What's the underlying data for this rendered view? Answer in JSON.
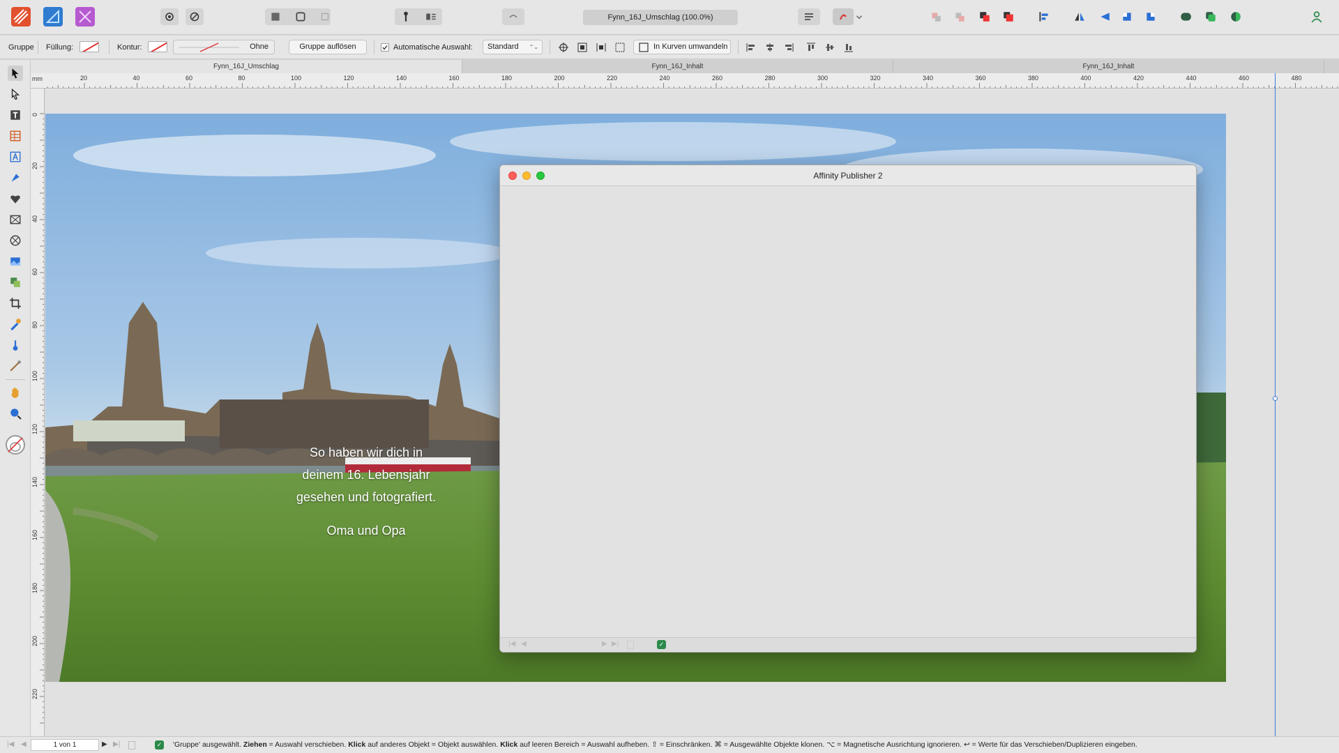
{
  "app": {
    "name": "Affinity Publisher 2"
  },
  "top_toolbar": {
    "document_title": "Fynn_16J_Umschlag (100.0%)",
    "persona_icons": [
      "publisher-persona-icon",
      "designer-persona-icon",
      "photo-persona-icon"
    ],
    "colors": {
      "publisher": "#e2502e",
      "designer": "#2f7bd0",
      "photo": "#b65ad0"
    }
  },
  "context_toolbar": {
    "selection_label": "Gruppe",
    "fill_label": "Füllung:",
    "stroke_label": "Kontur:",
    "stroke_style": "Ohne",
    "ungroup_button": "Gruppe auflösen",
    "auto_select_label": "Automatische Auswahl:",
    "auto_select_value": "Standard",
    "convert_curves_button": "In Kurven umwandeln"
  },
  "tabs": [
    {
      "label": "Fynn_16J_Umschlag",
      "active": true
    },
    {
      "label": "Fynn_16J_Inhalt",
      "active": false
    },
    {
      "label": "Fynn_16J_Inhalt",
      "active": false
    }
  ],
  "ruler": {
    "unit": "mm",
    "h_ticks": [
      "20",
      "40",
      "60",
      "80",
      "100",
      "120",
      "140",
      "160",
      "180",
      "200",
      "220",
      "240",
      "260",
      "280",
      "300",
      "320",
      "340",
      "360",
      "380",
      "400",
      "420",
      "440",
      "460",
      "480"
    ],
    "v_ticks": [
      "0",
      "20",
      "40",
      "60",
      "80",
      "100",
      "120",
      "140",
      "160",
      "180",
      "200",
      "220"
    ]
  },
  "page_content": {
    "caption_lines": [
      "So haben wir dich in",
      "deinem 16. Lebensjahr",
      "gesehen und fotografiert."
    ],
    "signature": "Oma und Opa"
  },
  "dialog": {
    "title": "Affinity Publisher 2"
  },
  "status_bar": {
    "page_indicator": "1 von 1",
    "message_parts": [
      {
        "text": "'Gruppe' ausgewählt. ",
        "bold": false
      },
      {
        "text": "Ziehen",
        "bold": true
      },
      {
        "text": " = Auswahl verschieben. ",
        "bold": false
      },
      {
        "text": "Klick",
        "bold": true
      },
      {
        "text": " auf anderes Objekt = Objekt auswählen. ",
        "bold": false
      },
      {
        "text": "Klick",
        "bold": true
      },
      {
        "text": " auf leeren Bereich = Auswahl aufheben. ⇧ = Einschränken. ⌘ = Ausgewählte Objekte klonen. ⌥ = Magnetische Ausrichtung ignorieren. ↩ = Werte für das Verschieben/Duplizieren eingeben.",
        "bold": false
      }
    ]
  }
}
